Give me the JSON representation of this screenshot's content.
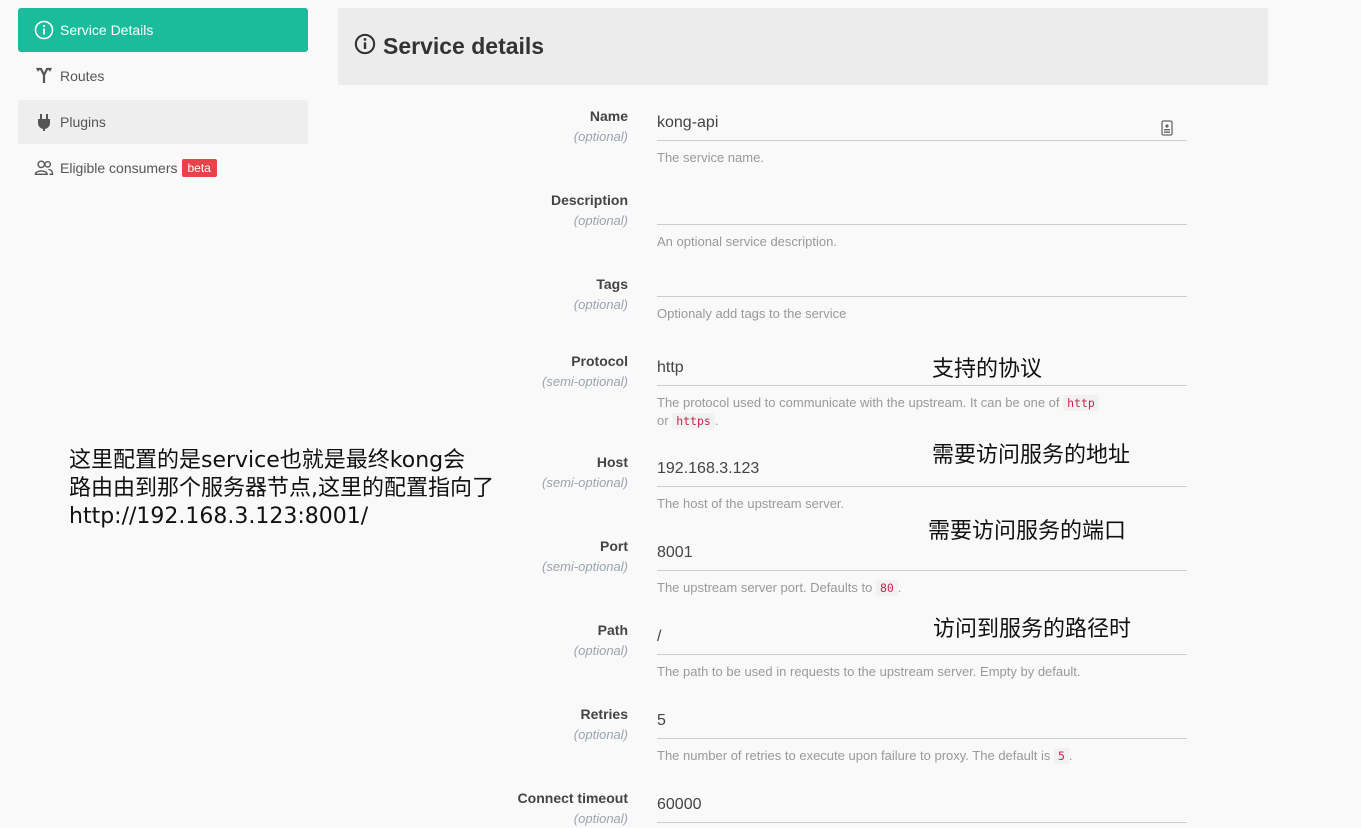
{
  "sidebar": {
    "items": [
      {
        "label": "Service Details",
        "icon": "info-icon"
      },
      {
        "label": "Routes",
        "icon": "routes-icon"
      },
      {
        "label": "Plugins",
        "icon": "plug-icon"
      },
      {
        "label": "Eligible consumers",
        "icon": "users-icon",
        "badge": "beta"
      }
    ]
  },
  "header": {
    "title": "Service details"
  },
  "fields": {
    "name": {
      "label": "Name",
      "optional": "(optional)",
      "value": "kong-api",
      "help": "The service name."
    },
    "description": {
      "label": "Description",
      "optional": "(optional)",
      "value": "",
      "help": "An optional service description."
    },
    "tags": {
      "label": "Tags",
      "optional": "(optional)",
      "value": "",
      "help": "Optionaly add tags to the service"
    },
    "protocol": {
      "label": "Protocol",
      "optional": "(semi-optional)",
      "value": "http",
      "help_pre": "The protocol used to communicate with the upstream. It can be one of",
      "code1": "http",
      "help_mid": "or",
      "code2": "https",
      "help_end": "."
    },
    "host": {
      "label": "Host",
      "optional": "(semi-optional)",
      "value": "192.168.3.123",
      "help": "The host of the upstream server."
    },
    "port": {
      "label": "Port",
      "optional": "(semi-optional)",
      "value": "8001",
      "help_pre": "The upstream server port. Defaults to",
      "code": "80",
      "help_end": "."
    },
    "path": {
      "label": "Path",
      "optional": "(optional)",
      "value": "/",
      "help": "The path to be used in requests to the upstream server. Empty by default."
    },
    "retries": {
      "label": "Retries",
      "optional": "(optional)",
      "value": "5",
      "help_pre": "The number of retries to execute upon failure to proxy. The default is",
      "code": "5",
      "help_end": "."
    },
    "connect_timeout": {
      "label": "Connect timeout",
      "optional": "(optional)",
      "value": "60000"
    }
  },
  "annotations": {
    "protocol": "支持的协议",
    "host": "需要访问服务的地址",
    "port": "需要访问服务的端口",
    "path": "访问到服务的路径时",
    "side_note": [
      "这里配置的是service也就是最终kong会",
      "路由由到那个服务器节点,这里的配置指向了",
      "http://192.168.3.123:8001/"
    ]
  },
  "colors": {
    "accent": "#1abc9c",
    "badge": "#e8424b",
    "code": "#c7254e"
  }
}
